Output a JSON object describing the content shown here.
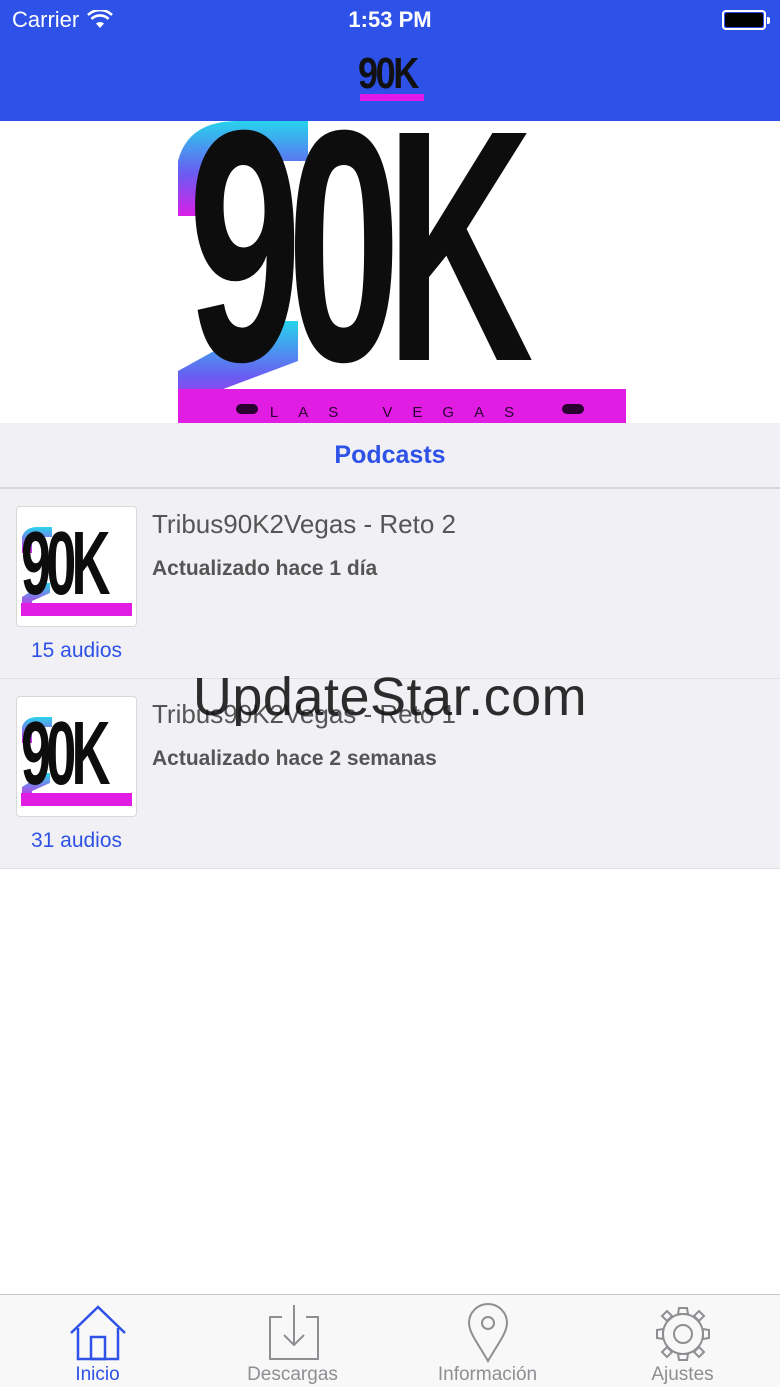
{
  "status_bar": {
    "carrier": "Carrier",
    "time": "1:53 PM"
  },
  "nav": {
    "logo_text": "90K"
  },
  "hero": {
    "logo_text": "90K",
    "subtitle": "LAS VEGAS"
  },
  "section": {
    "title": "Podcasts"
  },
  "podcasts": [
    {
      "thumb_text": "90K",
      "title": "Tribus90K2Vegas - Reto 2",
      "updated": "Actualizado hace 1 día",
      "count": "15 audios"
    },
    {
      "thumb_text": "90K",
      "title": "Tribus90K2Vegas - Reto 1",
      "updated": "Actualizado hace 2 semanas",
      "count": "31 audios"
    }
  ],
  "watermark": "UpdateStar.com",
  "tabbar": {
    "tabs": [
      {
        "label": "Inicio",
        "icon": "home-icon",
        "active": true
      },
      {
        "label": "Descargas",
        "icon": "download-icon",
        "active": false
      },
      {
        "label": "Información",
        "icon": "location-pin-icon",
        "active": false
      },
      {
        "label": "Ajustes",
        "icon": "gear-icon",
        "active": false
      }
    ]
  },
  "colors": {
    "accent": "#2e52e8",
    "brand_magenta": "#e11de4",
    "brand_cyan": "#27d3ec"
  }
}
